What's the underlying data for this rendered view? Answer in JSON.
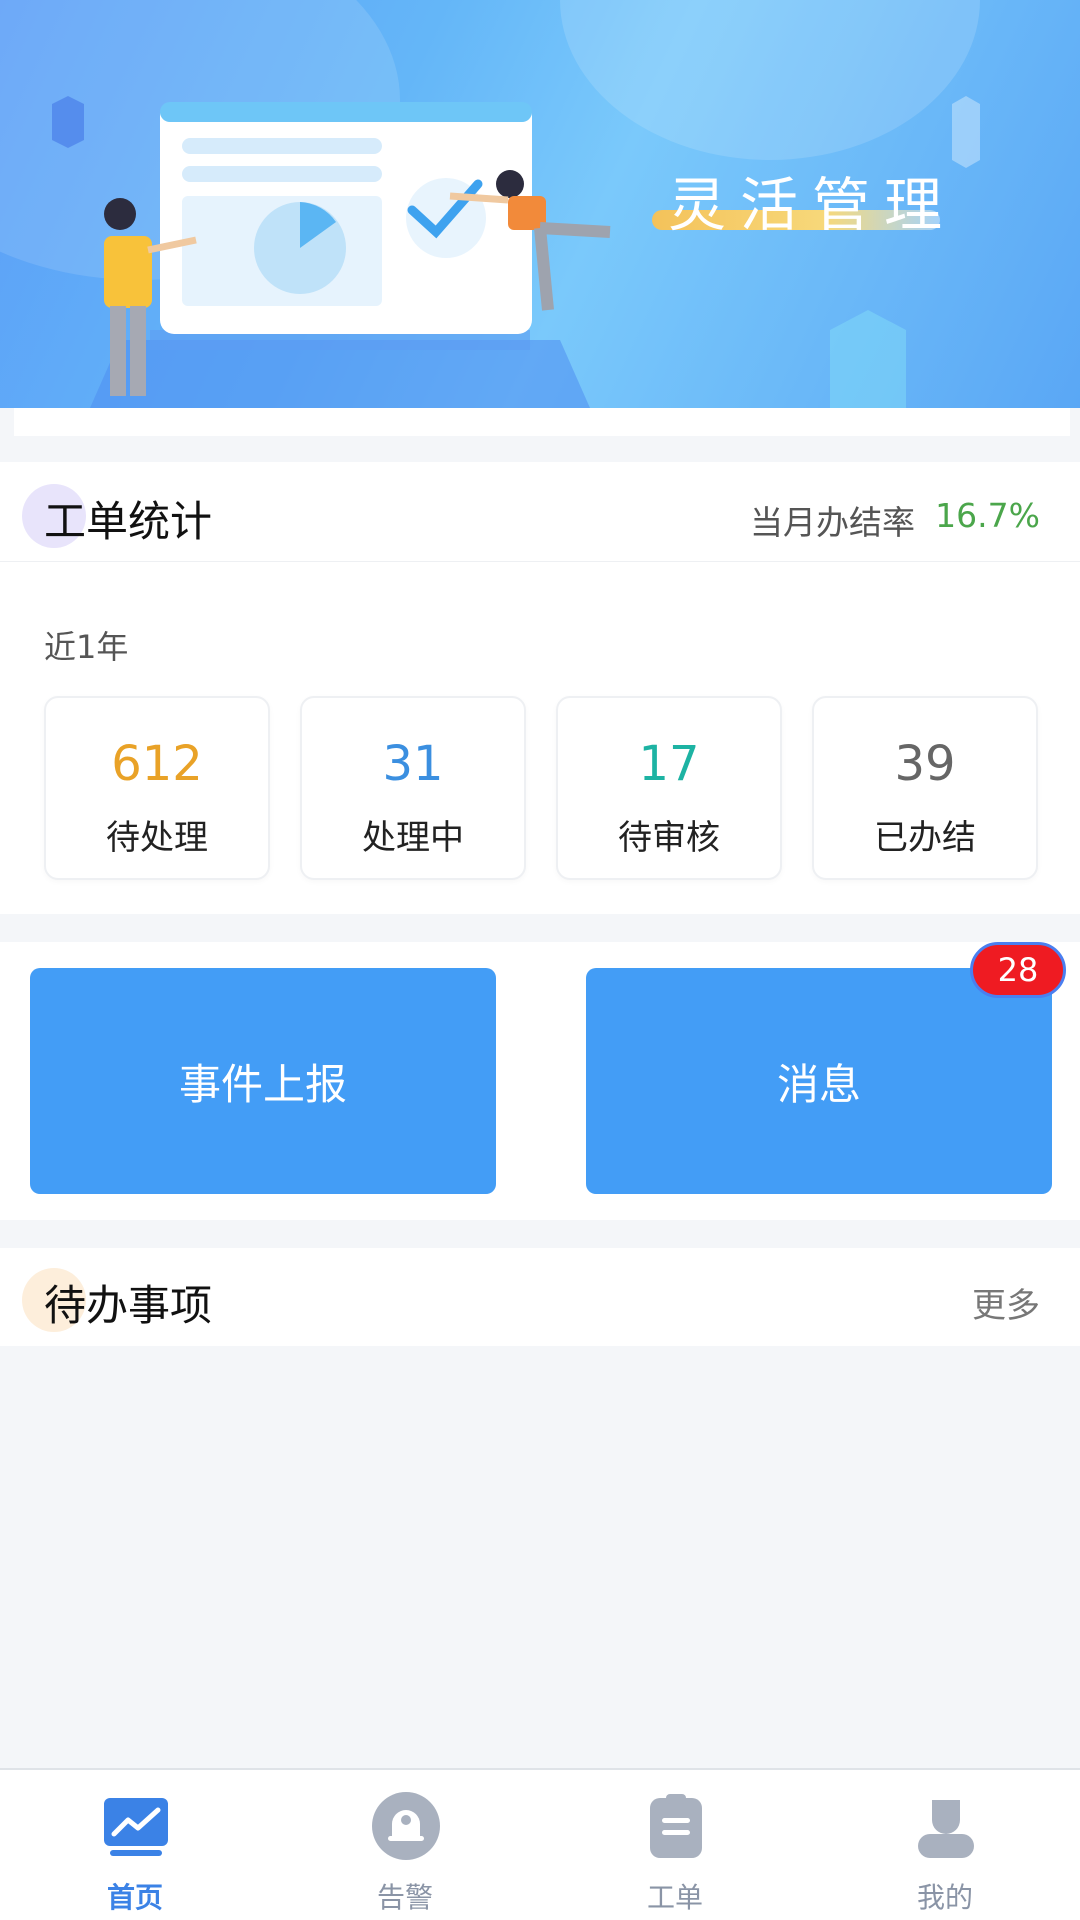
{
  "banner": {
    "title": "灵活管理"
  },
  "stats": {
    "title": "工单统计",
    "rate_label": "当月办结率",
    "rate_value": "16.7%",
    "period": "近1年",
    "items": [
      {
        "value": "612",
        "label": "待处理",
        "color": "#e9a227"
      },
      {
        "value": "31",
        "label": "处理中",
        "color": "#3b8fe0"
      },
      {
        "value": "17",
        "label": "待审核",
        "color": "#1db3a3"
      },
      {
        "value": "39",
        "label": "已办结",
        "color": "#666666"
      }
    ]
  },
  "actions": {
    "report_label": "事件上报",
    "message_label": "消息",
    "message_badge": "28"
  },
  "todo": {
    "title": "待办事项",
    "more": "更多"
  },
  "tabbar": {
    "items": [
      {
        "label": "首页",
        "icon": "home-chart-icon",
        "active": true
      },
      {
        "label": "告警",
        "icon": "bell-icon",
        "active": false
      },
      {
        "label": "工单",
        "icon": "clipboard-icon",
        "active": false
      },
      {
        "label": "我的",
        "icon": "user-icon",
        "active": false
      }
    ]
  },
  "colors": {
    "primary": "#439df6",
    "badge": "#ef1b22",
    "rate": "#4ba64b"
  }
}
